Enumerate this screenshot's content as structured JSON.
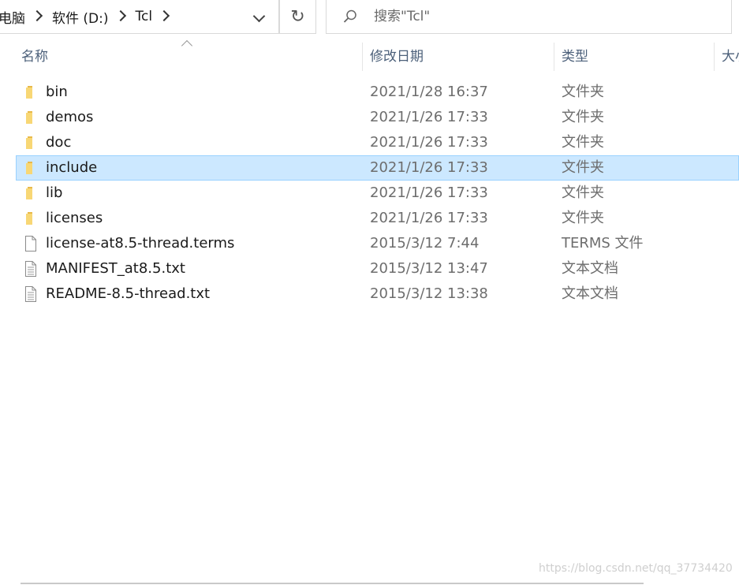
{
  "address_bar": {
    "crumbs": [
      "电脑",
      "软件 (D:)",
      "Tcl"
    ]
  },
  "search": {
    "placeholder": "搜索\"Tcl\""
  },
  "columns": {
    "name": "名称",
    "date": "修改日期",
    "type": "类型",
    "size": "大小"
  },
  "files": [
    {
      "name": "bin",
      "date": "2021/1/28 16:37",
      "type": "文件夹",
      "kind": "folder"
    },
    {
      "name": "demos",
      "date": "2021/1/26 17:33",
      "type": "文件夹",
      "kind": "folder"
    },
    {
      "name": "doc",
      "date": "2021/1/26 17:33",
      "type": "文件夹",
      "kind": "folder"
    },
    {
      "name": "include",
      "date": "2021/1/26 17:33",
      "type": "文件夹",
      "kind": "folder",
      "selected": true
    },
    {
      "name": "lib",
      "date": "2021/1/26 17:33",
      "type": "文件夹",
      "kind": "folder"
    },
    {
      "name": "licenses",
      "date": "2021/1/26 17:33",
      "type": "文件夹",
      "kind": "folder"
    },
    {
      "name": "license-at8.5-thread.terms",
      "date": "2015/3/12 7:44",
      "type": "TERMS 文件",
      "kind": "file"
    },
    {
      "name": "MANIFEST_at8.5.txt",
      "date": "2015/3/12 13:47",
      "type": "文本文档",
      "kind": "text"
    },
    {
      "name": "README-8.5-thread.txt",
      "date": "2015/3/12 13:38",
      "type": "文本文档",
      "kind": "text"
    }
  ],
  "watermark": "https://blog.csdn.net/qq_37734420",
  "icons": {
    "folder": "folder-icon",
    "file": "file-icon",
    "text": "text-file-icon",
    "refresh": "refresh-icon",
    "search": "search-icon",
    "chevron": "chevron-right-icon",
    "dropdown": "chevron-down-icon"
  },
  "colors": {
    "selection_bg": "#cce8ff",
    "selection_border": "#99d1ff",
    "folder": "#f8d775",
    "header_text": "#4c607a"
  }
}
